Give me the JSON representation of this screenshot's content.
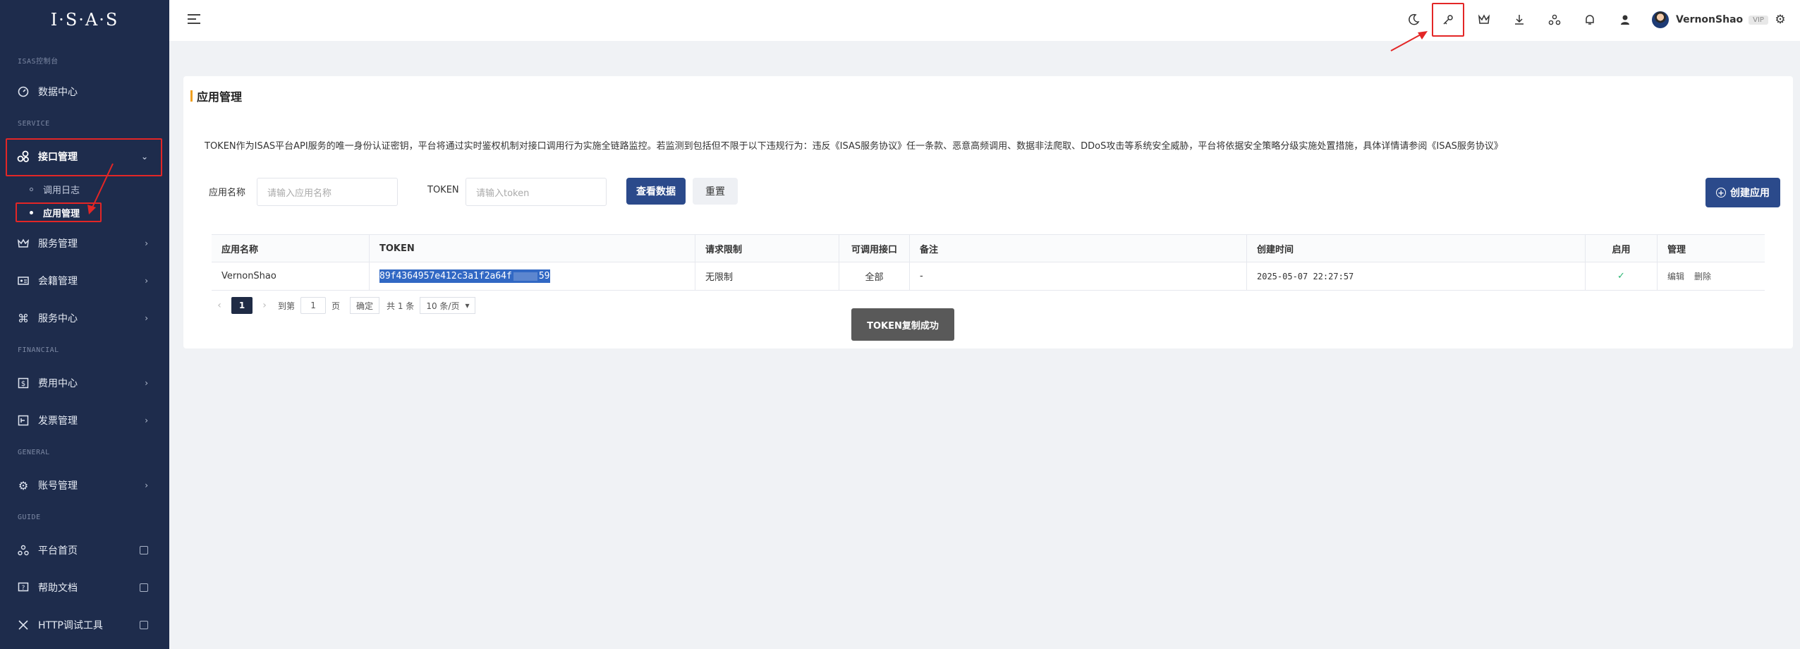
{
  "sidebar": {
    "logo": "I·S·A·S",
    "groups": [
      "ISAS控制台",
      "SERVICE",
      "FINANCIAL",
      "GENERAL",
      "GUIDE"
    ],
    "items": [
      {
        "label": "数据中心",
        "icon": "dashboard-icon"
      },
      {
        "label": "接口管理",
        "icon": "api-icon"
      },
      {
        "label": "服务管理",
        "icon": "crown-icon"
      },
      {
        "label": "会籍管理",
        "icon": "id-card-icon"
      },
      {
        "label": "服务中心",
        "icon": "command-icon"
      },
      {
        "label": "费用中心",
        "icon": "dollar-icon"
      },
      {
        "label": "发票管理",
        "icon": "invoice-icon"
      },
      {
        "label": "账号管理",
        "icon": "gear-icon"
      },
      {
        "label": "平台首页",
        "icon": "nodes-icon"
      },
      {
        "label": "帮助文档",
        "icon": "help-icon"
      },
      {
        "label": "HTTP调试工具",
        "icon": "tools-icon"
      }
    ],
    "sub_items": [
      "调用日志",
      "应用管理"
    ]
  },
  "header": {
    "user_name": "VernonShao",
    "badge": "VIP"
  },
  "main": {
    "title": "应用管理",
    "notice": "TOKEN作为ISAS平台API服务的唯一身份认证密钥，平台将通过实时鉴权机制对接口调用行为实施全链路监控。若监测到包括但不限于以下违规行为：违反《ISAS服务协议》任一条款、恶意高频调用、数据非法爬取、DDoS攻击等系统安全威胁，平台将依据安全策略分级实施处置措施，具体详情请参阅《ISAS服务协议》",
    "filters": {
      "app_name_label": "应用名称",
      "app_name_placeholder": "请输入应用名称",
      "token_label": "TOKEN",
      "token_placeholder": "请输入token",
      "query_button": "查看数据",
      "reset_button": "重置",
      "create_button": "创建应用"
    },
    "table": {
      "headers": [
        "应用名称",
        "TOKEN",
        "请求限制",
        "可调用接口",
        "备注",
        "创建时间",
        "启用",
        "管理"
      ],
      "rows": [
        {
          "name": "VernonShao",
          "token_start": "89f4364957e412c3a1f2a64f",
          "token_end": "59",
          "limit": "无限制",
          "apis": "全部",
          "remark": "-",
          "created": "2025-05-07 22:27:57",
          "enabled": "✓",
          "edit": "编辑",
          "delete": "删除"
        }
      ]
    },
    "pager": {
      "current": "1",
      "goto_label": "到第",
      "goto_value": "1",
      "page_unit": "页",
      "confirm": "确定",
      "total": "共 1 条",
      "page_size": "10 条/页"
    },
    "toast": "TOKEN复制成功"
  },
  "colors": {
    "sidebar_bg": "#1e2c4c",
    "primary": "#2b4a8b",
    "highlight_box": "#e32626",
    "selection": "#3168c4"
  }
}
